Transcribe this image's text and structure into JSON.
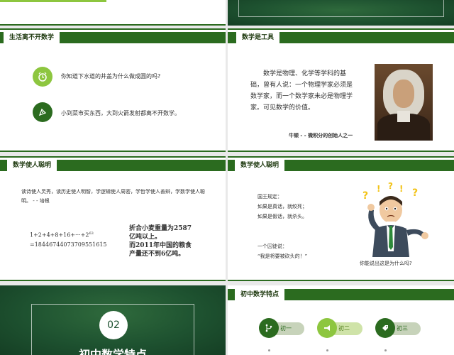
{
  "slide1": {
    "title": "生活离不开数学",
    "q1": "你知道下水道的井盖为什么做成圆的吗?",
    "q2": "小到菜市买东西，大到火箭发射都离不开数学。"
  },
  "slide2": {
    "title": "数学是工具",
    "body": "数学是物理、化学等学科的基础，曾有人说：一个物理学家必须是数学家，而一个数学家未必是物理学家。可见数学的价值。",
    "caption": "牛顿 - - 微积分的创始人之一"
  },
  "slide3": {
    "title": "数学使人聪明",
    "quote": "读诗使人灵秀，读历史使人明智，学逻辑使人周密，学哲学使人善辩，学数学使人聪明。 - - 培根",
    "formula1": "1+2+4+8+16+···+2",
    "formula_exp": "63",
    "formula2": "=18446744073709551615",
    "note1": "折合小麦重量为2587",
    "note2": "亿吨以上。",
    "note3": "而2011年中国的粮食",
    "note4": "产量还不到6亿吨。"
  },
  "slide4": {
    "title": "数学使人聪明",
    "line1": "国王规定：",
    "line2": "如果是真话，就绞死；",
    "line3": "如果是假话，就杀头。",
    "line4": "一个囚徒说：",
    "line5": "“我是将要被砍头的！”",
    "question": "你能说出这是为什么吗?"
  },
  "slide5": {
    "number": "02",
    "title": "初中数学特点"
  },
  "slide6": {
    "title": "初中数学特点",
    "items": [
      "初一",
      "初二",
      "初三"
    ]
  },
  "colors": {
    "dark_green": "#2b6b1f",
    "light_green": "#8dc63f",
    "text": "#333333"
  }
}
